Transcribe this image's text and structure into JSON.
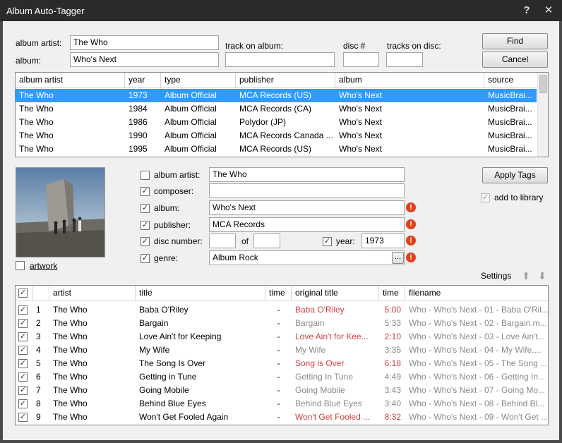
{
  "window": {
    "title": "Album Auto-Tagger",
    "help_glyph": "?",
    "close_glyph": "✕"
  },
  "search": {
    "album_artist_label": "album artist:",
    "album_artist_value": "The Who",
    "album_label": "album:",
    "album_value": "Who's Next",
    "track_on_album_label": "track on album:",
    "track_on_album_value": "",
    "disc_label": "disc #",
    "disc_value": "",
    "tracks_on_disc_label": "tracks on disc:",
    "tracks_on_disc_value": "",
    "find_label": "Find",
    "cancel_label": "Cancel"
  },
  "results": {
    "columns": [
      "album artist",
      "year",
      "type",
      "publisher",
      "album",
      "source"
    ],
    "rows": [
      [
        "The Who",
        "1973",
        "Album Official",
        "MCA Records (US)",
        "Who's Next",
        "MusicBrai..."
      ],
      [
        "The Who",
        "1984",
        "Album Official",
        "MCA Records (CA)",
        "Who's Next",
        "MusicBrai..."
      ],
      [
        "The Who",
        "1986",
        "Album Official",
        "Polydor (JP)",
        "Who's Next",
        "MusicBrai..."
      ],
      [
        "The Who",
        "1990",
        "Album Official",
        "MCA Records Canada ...",
        "Who's Next",
        "MusicBrai..."
      ],
      [
        "The Who",
        "1995",
        "Album Official",
        "MCA Records (US)",
        "Who's Next",
        "MusicBrai..."
      ]
    ],
    "selected_index": 0
  },
  "tags": {
    "album_artist": {
      "label": "album artist:",
      "value": "The Who",
      "checked": false
    },
    "composer": {
      "label": "composer:",
      "value": "",
      "checked": true
    },
    "album": {
      "label": "album:",
      "value": "Who's Next",
      "checked": true
    },
    "publisher": {
      "label": "publisher:",
      "value": "MCA Records",
      "checked": true
    },
    "disc_number": {
      "label": "disc number:",
      "value": "",
      "of_label": "of",
      "of_value": "",
      "checked": true
    },
    "year": {
      "label": "year:",
      "value": "1973",
      "checked": true
    },
    "genre": {
      "label": "genre:",
      "value": "Album Rock",
      "checked": true,
      "browse_label": "..."
    },
    "warning_glyph": "!",
    "check_glyph": "✓",
    "artwork_label": "artwork",
    "apply_label": "Apply Tags",
    "add_to_library_label": "add to library",
    "settings_label": "Settings",
    "move_up_glyph": "⬆",
    "move_down_glyph": "⬇"
  },
  "tracks": {
    "columns": [
      "artist",
      "title",
      "time",
      "original title",
      "time",
      "filename"
    ],
    "rows": [
      {
        "num": "1",
        "artist": "The Who",
        "title": "Baba O'Riley",
        "time": "-",
        "orig": "Baba O'Riley",
        "otime": "5:00",
        "file": "Who - Who's Next - 01 - Baba O'Ril...",
        "diff": true
      },
      {
        "num": "2",
        "artist": "The Who",
        "title": "Bargain",
        "time": "-",
        "orig": "Bargain",
        "otime": "5:33",
        "file": "Who - Who's Next - 02 - Bargain.m...",
        "diff": false
      },
      {
        "num": "3",
        "artist": "The Who",
        "title": "Love Ain't for Keeping",
        "time": "-",
        "orig": "Love Ain't for Kee...",
        "otime": "2:10",
        "file": "Who - Who's Next - 03 - Love Ain't...",
        "diff": true
      },
      {
        "num": "4",
        "artist": "The Who",
        "title": "My Wife",
        "time": "-",
        "orig": "My Wife",
        "otime": "3:35",
        "file": "Who - Who's Next - 04 - My Wife....",
        "diff": false
      },
      {
        "num": "5",
        "artist": "The Who",
        "title": "The Song Is Over",
        "time": "-",
        "orig": "Song is Over",
        "otime": "6:18",
        "file": "Who - Who's Next - 05 - The Song ...",
        "diff": true
      },
      {
        "num": "6",
        "artist": "The Who",
        "title": "Getting in Tune",
        "time": "-",
        "orig": "Getting In Tune",
        "otime": "4:49",
        "file": "Who - Who's Next - 06 - Getting In...",
        "diff": false
      },
      {
        "num": "7",
        "artist": "The Who",
        "title": "Going Mobile",
        "time": "-",
        "orig": "Going Mobile",
        "otime": "3:43",
        "file": "Who - Who's Next - 07 - Going Mo...",
        "diff": false
      },
      {
        "num": "8",
        "artist": "The Who",
        "title": "Behind Blue Eyes",
        "time": "-",
        "orig": "Behind Blue Eyes",
        "otime": "3:40",
        "file": "Who - Who's Next - 08 - Behind Bl...",
        "diff": false
      },
      {
        "num": "9",
        "artist": "The Who",
        "title": "Won't Get Fooled Again",
        "time": "-",
        "orig": "Won't Get Fooled ...",
        "otime": "8:32",
        "file": "Who - Who's Next - 09 - Won't Get ...",
        "diff": true
      }
    ]
  }
}
